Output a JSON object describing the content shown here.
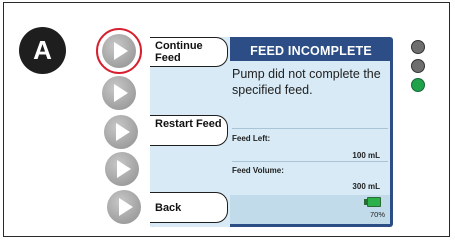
{
  "badge": {
    "label": "A"
  },
  "screen": {
    "title": "FEED INCOMPLETE",
    "message": "Pump did not complete the specified feed.",
    "fields": [
      {
        "label": "Feed Left:",
        "value": "100 mL"
      },
      {
        "label": "Feed Volume:",
        "value": "300 mL"
      }
    ],
    "battery": {
      "percent": 0.7,
      "label": "70%"
    }
  },
  "soft_keys": [
    {
      "label": "Continue Feed",
      "selected": true
    },
    {
      "label": "",
      "selected": false
    },
    {
      "label": "Restart Feed",
      "selected": false
    },
    {
      "label": "",
      "selected": false
    },
    {
      "label": "Back",
      "selected": false
    }
  ],
  "indicators": [
    {
      "name": "top-led",
      "color": "#6e6e6e"
    },
    {
      "name": "middle-led",
      "color": "#6e6e6e"
    },
    {
      "name": "bottom-led",
      "color": "#1fa24a"
    }
  ],
  "colors": {
    "header": "#2d4d86",
    "content_bg": "#d7eaf5",
    "highlight_ring": "#d62030",
    "battery": "#2bb04a"
  }
}
